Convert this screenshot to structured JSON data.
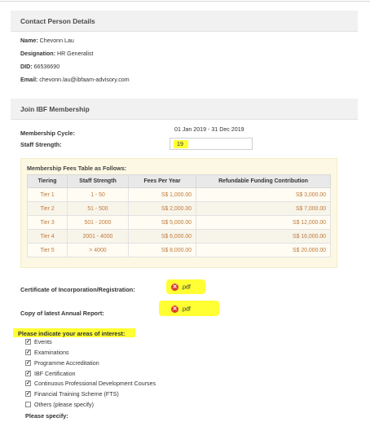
{
  "contact": {
    "heading": "Contact Person Details",
    "name_label": "Name:",
    "name_value": "Chevonn Lau",
    "designation_label": "Designation:",
    "designation_value": "HR Generalist",
    "did_label": "DID:",
    "did_value": "66536690",
    "email_label": "Email:",
    "email_value": "chevonn.lau@ibfaam-advisory.com"
  },
  "membership": {
    "heading": "Join IBF Membership",
    "cycle_label": "Membership Cycle:",
    "cycle_value": "01 Jan 2019 - 31 Dec 2019",
    "staff_label": "Staff Strength:",
    "staff_value": "19"
  },
  "fees": {
    "title": "Membership Fees Table as Follows:",
    "headers": [
      "Tiering",
      "Staff Strength",
      "Fees Per Year",
      "Refundable Funding Contribution"
    ],
    "rows": [
      [
        "Tier 1",
        "1 - 50",
        "S$ 1,000.00",
        "S$ 3,000.00"
      ],
      [
        "Tier 2",
        "51 - 500",
        "S$ 2,000.00",
        "S$ 7,000.00"
      ],
      [
        "Tier 3",
        "501 - 2000",
        "S$ 5,000.00",
        "S$ 12,000.00"
      ],
      [
        "Tier 4",
        "2001 - 4000",
        "S$ 6,000.00",
        "S$ 16,000.00"
      ],
      [
        "Tier 5",
        "> 4000",
        "S$ 8,000.00",
        "S$ 20,000.00"
      ]
    ]
  },
  "documents": {
    "cert_label": "Certificate of Incorporation/Registration:",
    "cert_file": ".pdf",
    "report_label": "Copy of latest Annual Report:",
    "report_file": ".pdf",
    "remove_icon": "x-circle-icon"
  },
  "interests": {
    "label": "Please indicate your areas of interest:",
    "options": [
      {
        "label": "Events",
        "checked": true
      },
      {
        "label": "Examinations",
        "checked": true
      },
      {
        "label": "Programme Accreditation",
        "checked": true
      },
      {
        "label": "IBF Certification",
        "checked": true
      },
      {
        "label": "Continuous Professional Development Courses",
        "checked": true
      },
      {
        "label": "Financial Training Scheme (FTS)",
        "checked": true
      },
      {
        "label": "Others (please specify)",
        "checked": false
      }
    ],
    "specify_label": "Please specify:"
  },
  "colors": {
    "highlight": "#ffff33",
    "table_text": "#c17a3a",
    "panel_bg": "#fcf8e3"
  }
}
